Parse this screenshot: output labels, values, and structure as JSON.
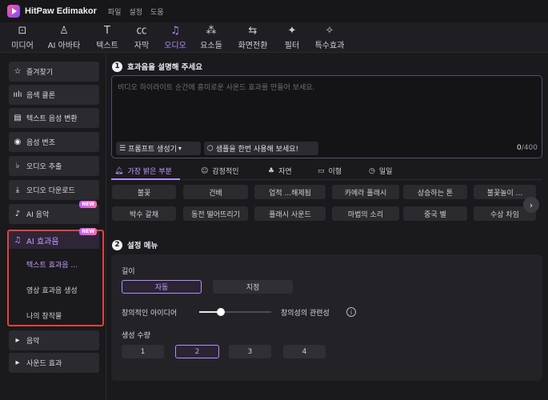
{
  "app": {
    "title": "HitPaw Edimakor"
  },
  "menu": [
    "파일",
    "설정",
    "도움"
  ],
  "toolbar": [
    {
      "label": "미디어",
      "icon": "media-icon"
    },
    {
      "label": "AI 아바타",
      "icon": "avatar-icon"
    },
    {
      "label": "텍스트",
      "icon": "text-icon"
    },
    {
      "label": "자막",
      "icon": "subtitle-icon"
    },
    {
      "label": "오디오",
      "icon": "audio-icon",
      "active": true
    },
    {
      "label": "요소들",
      "icon": "elements-icon"
    },
    {
      "label": "화면전환",
      "icon": "transition-icon"
    },
    {
      "label": "필터",
      "icon": "filter-icon"
    },
    {
      "label": "특수효과",
      "icon": "effects-icon"
    }
  ],
  "sidebar": {
    "items": [
      {
        "label": "즐겨찾기",
        "icon": "star-icon"
      },
      {
        "label": "음색 클론",
        "icon": "waveform-icon"
      },
      {
        "label": "텍스트 음성 변환",
        "icon": "text-to-speech-icon"
      },
      {
        "label": "음성 변조",
        "icon": "voice-changer-icon"
      },
      {
        "label": "오디오 추출",
        "icon": "microphone-icon"
      },
      {
        "label": "오디오 다운로드",
        "icon": "download-icon"
      },
      {
        "label": "AI 음악",
        "icon": "music-note-icon",
        "badge": "NEW"
      }
    ],
    "ai_effects": {
      "label": "AI 효과음",
      "badge": "NEW",
      "subitems": [
        "텍스트 효과음 ...",
        "영상 효과음 생성",
        "나의 창작물"
      ]
    },
    "bottom_items": [
      {
        "label": "음악"
      },
      {
        "label": "사운드 효과"
      }
    ]
  },
  "main": {
    "section1": {
      "number": "1",
      "title": "효과음을 설명해 주세요"
    },
    "prompt": {
      "placeholder": "비디오 하이라이트 순간에 흥미로운 사운드 효과를 만들어 보세요.",
      "generator_button": "프롬프트 생성기",
      "sample_button": "샘플을 한번 사용해 보세요!",
      "count": "0",
      "max": "/400"
    },
    "tabs": [
      {
        "label": "가장 밝은 부분",
        "icon": "bell-icon",
        "active": true
      },
      {
        "label": "감정적인",
        "icon": "smiley-icon"
      },
      {
        "label": "자연",
        "icon": "tree-icon"
      },
      {
        "label": "이형",
        "icon": "transform-icon"
      },
      {
        "label": "일일",
        "icon": "clock-icon"
      }
    ],
    "chips_row1": [
      "불꽃",
      "건배",
      "업적 ...해제됨",
      "카메라 플래시",
      "상승하는 톤",
      "불꽃놀이 ..."
    ],
    "chips_row2": [
      "박수 갈채",
      "동전 떨어뜨리기",
      "플래시 사운드",
      "마법의 소리",
      "중국 벨",
      "수상 차임"
    ],
    "section2": {
      "number": "2",
      "title": "설정 메뉴"
    },
    "settings": {
      "length_label": "길이",
      "length_options": [
        "자동",
        "지정"
      ],
      "creativity_label": "창의적인 아이디어",
      "relevance_label": "창의성의 관련성",
      "creativity_value": 0.3,
      "count_label": "생성 수량",
      "count_options": [
        "1",
        "2",
        "3",
        "4"
      ],
      "count_selected": "2"
    }
  }
}
